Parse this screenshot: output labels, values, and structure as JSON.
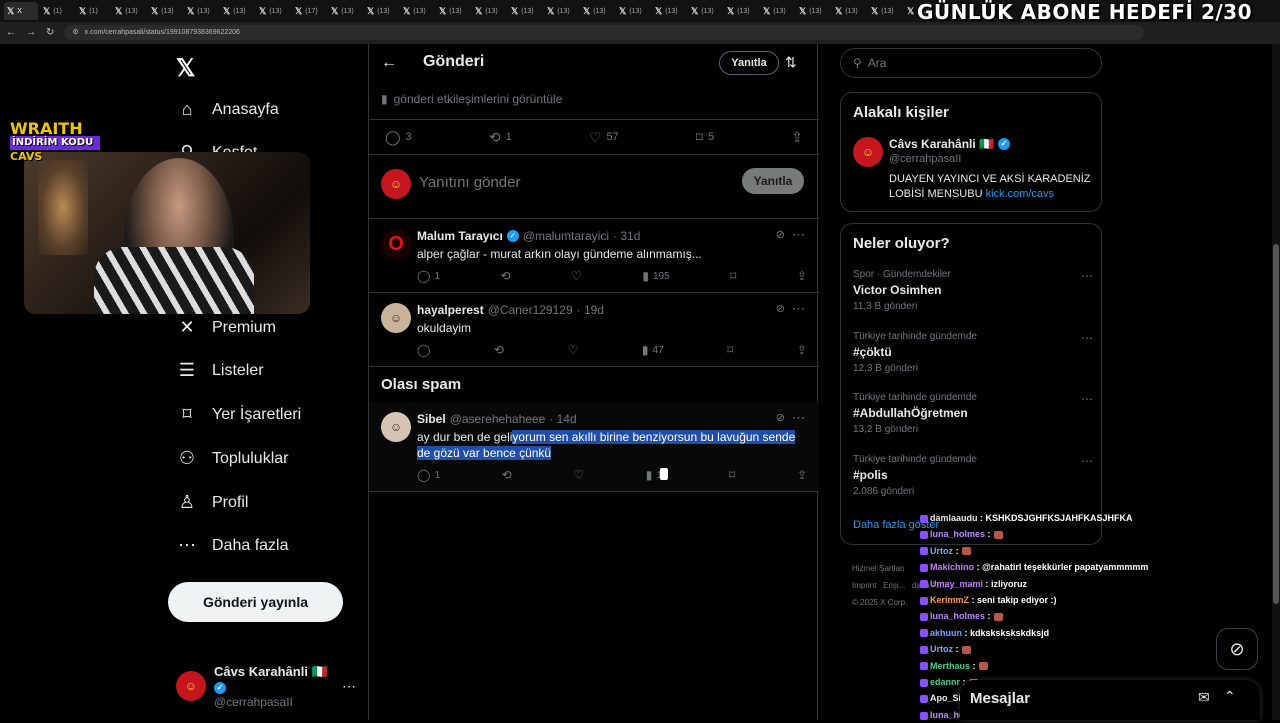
{
  "browser": {
    "tabs": [
      "X",
      "(1)",
      "(1)",
      "(13)",
      "(13)",
      "(13)",
      "(13)",
      "(13)",
      "(17)",
      "(13)",
      "(13)",
      "(13)",
      "(13)",
      "(13)",
      "(13)",
      "(13)",
      "(13)",
      "(13)",
      "(13)",
      "(13)",
      "(13)",
      "(13)",
      "(13)",
      "(13)",
      "(13)",
      "(13)",
      "(13)"
    ],
    "url": "x.com/cerrahpasali/status/1991087938369622206"
  },
  "stream_overlay": {
    "goal_text": "GÜNLÜK ABONE HEDEFİ 2/30",
    "brand_line1": "WRAITH",
    "brand_line2": "İNDİRİM KODU",
    "brand_line3": "CAVS"
  },
  "sidebar": {
    "items": [
      {
        "label": "Anasayfa",
        "icon": "home-icon"
      },
      {
        "label": "Keşfet",
        "icon": "search-icon"
      },
      {
        "label": "Premium",
        "icon": "x-icon"
      },
      {
        "label": "Listeler",
        "icon": "list-icon"
      },
      {
        "label": "Yer İşaretleri",
        "icon": "bookmark-icon"
      },
      {
        "label": "Topluluklar",
        "icon": "communities-icon"
      },
      {
        "label": "Profil",
        "icon": "profile-icon"
      },
      {
        "label": "Daha fazla",
        "icon": "more-icon"
      }
    ],
    "post_button": "Gönderi yayınla",
    "account": {
      "name": "Câvs Karahânli 🇮🇹",
      "handle": "@cerrahpasaII"
    }
  },
  "main": {
    "title": "Gönderi",
    "reply_button": "Yanıtla",
    "engagements_link": "gönderi etkileşimlerini görüntüle",
    "stats": {
      "replies": "3",
      "reposts": "1",
      "likes": "57",
      "bookmarks": "5"
    },
    "reply_placeholder": "Yanıtını gönder",
    "reply_submit": "Yanıtla",
    "replies": [
      {
        "name": "Malum Tarayıcı",
        "handle": "@malumtarayici",
        "time": "· 31d",
        "text": "alper çağlar - murat arkın olayı gündeme alınmamış...",
        "replies": "1",
        "views": "195"
      },
      {
        "name": "hayalperest",
        "handle": "@Caner129129",
        "time": "· 19d",
        "text": "okuldayim",
        "replies": "",
        "views": "47"
      }
    ],
    "spam_title": "Olası spam",
    "spam_reply": {
      "name": "Sibel",
      "handle": "@aserehehaheee",
      "time": "· 14d",
      "text_plain": "ay dur ben de geli",
      "text_selected": "yorum sen akıllı birine benziyorsun bu lavuğun sende de gözü var bence çünkü",
      "replies": "1",
      "views": "15"
    }
  },
  "right": {
    "search_placeholder": "Ara",
    "related_title": "Alakalı kişiler",
    "related_person": {
      "name": "Câvs Karahânli 🇮🇹",
      "handle": "@cerrahpasaII",
      "bio": "DUAYEN YAYINCI VE AKSİ KARADENİZ LOBİSİ MENSUBU",
      "link": "kick.com/cavs"
    },
    "trends_title": "Neler oluyor?",
    "trends": [
      {
        "category": "Spor · Gündemdekiler",
        "name": "Victor Osimhen",
        "count": "11,3 B gönderi"
      },
      {
        "category": "Türkiye tarihinde gündemde",
        "name": "#çöktü",
        "count": "12,3 B gönderi"
      },
      {
        "category": "Türkiye tarihinde gündemde",
        "name": "#AbdullahÖğretmen",
        "count": "13,2 B gönderi"
      },
      {
        "category": "Türkiye tarihinde gündemde",
        "name": "#polis",
        "count": "2.086 gönderi"
      }
    ],
    "show_more": "Daha fazla göster",
    "footer": [
      "Hizmet Şartları",
      "Imprint",
      "Erişi...",
      "daha fazla ...",
      "© 2025 X Corp."
    ]
  },
  "chat": [
    {
      "user": "damlaaudu",
      "msg": ": KSHKDSJGHFKSJAHFKASJHFKA",
      "color": "#e8e8e8"
    },
    {
      "user": "luna_holmes",
      "msg": ":",
      "color": "#b98cff",
      "emote": true
    },
    {
      "user": "Urtoz",
      "msg": ":",
      "color": "#6fa8ff",
      "emote": true
    },
    {
      "user": "Makichino",
      "msg": ": @rahatirl teşekkürler papatyammmmm",
      "color": "#c77dff"
    },
    {
      "user": "Umay_mami",
      "msg": ": izliyoruz",
      "color": "#c77dff"
    },
    {
      "user": "KerimmZ",
      "msg": ": seni takip ediyor :)",
      "color": "#ff9a3c"
    },
    {
      "user": "luna_holmes",
      "msg": ":",
      "color": "#b98cff",
      "emote": true
    },
    {
      "user": "akhuun",
      "msg": ": kdkskskskskdksjd",
      "color": "#6fa8ff"
    },
    {
      "user": "Urtoz",
      "msg": ":",
      "color": "#6fa8ff",
      "emote": true
    },
    {
      "user": "Merthaus",
      "msg": ":",
      "color": "#3ecf8e",
      "emote": true
    },
    {
      "user": "edannr",
      "msg": ":",
      "color": "#3ecf8e",
      "emote": true
    },
    {
      "user": "Apo_Siken",
      "msg": "",
      "color": "#e8e8e8"
    },
    {
      "user": "luna_holmes",
      "msg": ":",
      "color": "#b98cff",
      "emote": true
    }
  ],
  "messages_bar": {
    "title": "Mesajlar"
  }
}
